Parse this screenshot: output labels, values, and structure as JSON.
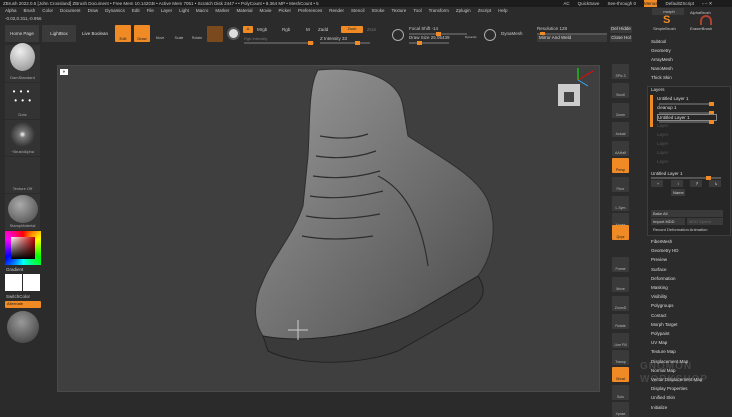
{
  "titlebar": {
    "text": "ZBrush 2022.0.5 [John Crossland]   ZBrush Document   • Free Mem 10.142GB • Active Mem 7051 • Scratch Disk 2447 • • PolyCount • 8.364 MP • MeshCount • 5",
    "ac": "AC",
    "quicksave": "QuickSave",
    "seethrough": "See-through 0",
    "menus": "Menus",
    "script": "DefaultZScript"
  },
  "menu": [
    "Alpha",
    "Brush",
    "Color",
    "Document",
    "Draw",
    "Dynamics",
    "Edit",
    "File",
    "Layer",
    "Light",
    "Macro",
    "Marker",
    "Material",
    "Movie",
    "Picker",
    "Preferences",
    "Render",
    "Stencil",
    "Stroke",
    "Texture",
    "Tool",
    "Transform",
    "Zplugin",
    "Zscript",
    "Help"
  ],
  "coords": "-0.02,0.311,-0.956",
  "toolbar": {
    "home": "Home Page",
    "lightbox": "LightBox",
    "liveboolean": "Live Boolean",
    "edit": "Edit",
    "draw": "Draw",
    "move": "Move",
    "scale": "Scale",
    "rotate": "Rotate",
    "a": "A",
    "mrgb": "Mrgb",
    "rgb": "Rgb",
    "m": "M",
    "zadd": "Zadd",
    "zsub": "Zsub",
    "zcut": "Zcut",
    "rgb_intensity": "Rgb Intensity",
    "z_intensity": "Z Intensity 33",
    "focal_shift": "Focal Shift -14",
    "draw_size": "Draw Size 25.05439",
    "dynamic": "Dynamic",
    "dynamesh": "DynaMesh",
    "resolution": "Resolution 128",
    "mirror_weld": "Mirror And Weld",
    "del_hidden": "Del Hidde",
    "close_holes": "Close Hol",
    "z_intensity_value": 0.33,
    "focal_shift_value": -14,
    "resolution_value": 128
  },
  "left": {
    "brush": "DamStandard",
    "stroke": "Dots",
    "alpha": "~BrushAlpha",
    "texture": "Texture Off",
    "material": "StampMaterial",
    "gradient": "Gradient",
    "switch": "SwitchColor",
    "alternate": "Alternate"
  },
  "rshelf": [
    {
      "l": "SPix 3"
    },
    {
      "l": "Scroll"
    },
    {
      "l": "Zoom"
    },
    {
      "l": "Actual"
    },
    {
      "l": "AAHalf"
    },
    {
      "l": "Persp",
      "on": true
    },
    {
      "l": "Floor"
    },
    {
      "l": "L.Sym"
    },
    {
      "l": "Xpose"
    },
    {
      "l": "Qxyz",
      "on": true
    },
    {
      "l": "Frame"
    },
    {
      "l": "Move"
    },
    {
      "l": "ZoomD"
    },
    {
      "l": "Rotate"
    },
    {
      "l": "Line Fill"
    },
    {
      "l": "Transp"
    },
    {
      "l": "Ghost",
      "on": true
    },
    {
      "l": "Solo"
    },
    {
      "l": "Xpose"
    }
  ],
  "rpanel": {
    "morph": "morph",
    "alphabrush": "AlphaBrush",
    "simplebrush": "SimpleBrush",
    "eraserbrush": "EraserBrush",
    "top_items": [
      "Subtool",
      "Geometry",
      "ArrayMesh",
      "NanoMesh",
      "Thick Skin"
    ],
    "layers_title": "Layers",
    "layers": [
      "Untitled Layer 1",
      "cleanup 1",
      "Untitled Layer 1"
    ],
    "empty_layer": "Layer",
    "current_layer": "Untitled Layer 1",
    "name_btn": "Name",
    "bake_all": "Bake All",
    "import_mdd": "Import MDD",
    "mdd_speed": "MDD Speed",
    "record": "Record Deformation Animation",
    "items": [
      "FiberMesh",
      "Geometry HD",
      "Preview",
      "Surface",
      "Deformation",
      "Masking",
      "Visibility",
      "Polygroups",
      "Contact",
      "Morph Target",
      "Polypaint",
      "UV Map",
      "Texture Map",
      "Displacement Map",
      "Normal Map",
      "Vector Displacement Map",
      "Display Properties",
      "Unified Skin",
      "Initialize"
    ]
  },
  "watermark": "THE GNOMON WORKSHOP"
}
